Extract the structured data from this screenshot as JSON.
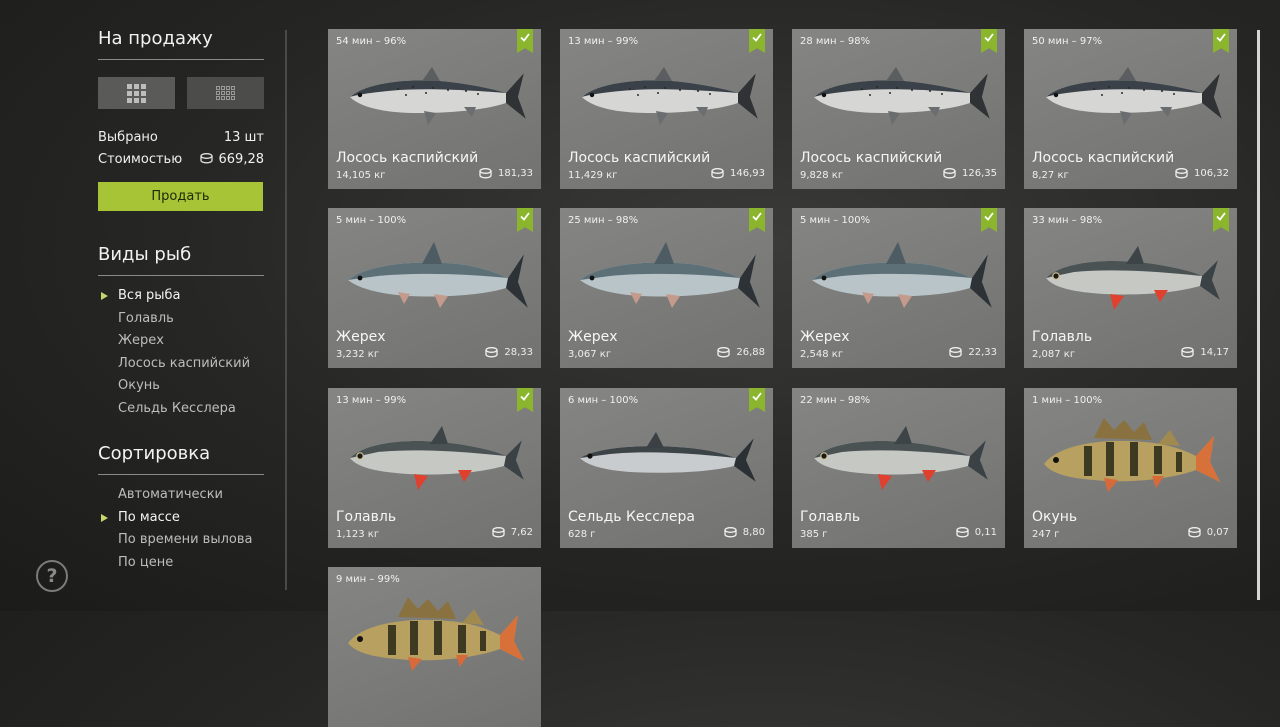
{
  "sidebar": {
    "sale_title": "На продажу",
    "selected_label": "Выбрано",
    "selected_value": "13 шт",
    "cost_label": "Стоимостью",
    "cost_value": "669,28",
    "sell_label": "Продать",
    "species_title": "Виды рыб",
    "species": [
      {
        "label": "Вся рыба",
        "selected": true
      },
      {
        "label": "Голавль",
        "selected": false
      },
      {
        "label": "Жерех",
        "selected": false
      },
      {
        "label": "Лосось каспийский",
        "selected": false
      },
      {
        "label": "Окунь",
        "selected": false
      },
      {
        "label": "Сельдь Кесслера",
        "selected": false
      }
    ],
    "sort_title": "Сортировка",
    "sort": [
      {
        "label": "Автоматически",
        "selected": false
      },
      {
        "label": "По массе",
        "selected": true
      },
      {
        "label": "По времени вылова",
        "selected": false
      },
      {
        "label": "По цене",
        "selected": false
      }
    ],
    "help_label": "?"
  },
  "cards": [
    {
      "info": "54 мин – 96%",
      "checked": true,
      "name": "Лосось каспийский",
      "weight": "14,105 кг",
      "price": "181,33",
      "fish": "salmon"
    },
    {
      "info": "13 мин – 99%",
      "checked": true,
      "name": "Лосось каспийский",
      "weight": "11,429 кг",
      "price": "146,93",
      "fish": "salmon"
    },
    {
      "info": "28 мин – 98%",
      "checked": true,
      "name": "Лосось каспийский",
      "weight": "9,828 кг",
      "price": "126,35",
      "fish": "salmon"
    },
    {
      "info": "50 мин – 97%",
      "checked": true,
      "name": "Лосось каспийский",
      "weight": "8,27 кг",
      "price": "106,32",
      "fish": "salmon"
    },
    {
      "info": "5 мин – 100%",
      "checked": true,
      "name": "Жерех",
      "weight": "3,232 кг",
      "price": "28,33",
      "fish": "asp"
    },
    {
      "info": "25 мин – 98%",
      "checked": true,
      "name": "Жерех",
      "weight": "3,067 кг",
      "price": "26,88",
      "fish": "asp"
    },
    {
      "info": "5 мин – 100%",
      "checked": true,
      "name": "Жерех",
      "weight": "2,548 кг",
      "price": "22,33",
      "fish": "asp"
    },
    {
      "info": "33 мин – 98%",
      "checked": true,
      "name": "Голавль",
      "weight": "2,087 кг",
      "price": "14,17",
      "fish": "chub"
    },
    {
      "info": "13 мин – 99%",
      "checked": true,
      "name": "Голавль",
      "weight": "1,123 кг",
      "price": "7,62",
      "fish": "chub"
    },
    {
      "info": "6 мин – 100%",
      "checked": true,
      "name": "Сельдь Кесслера",
      "weight": "628 г",
      "price": "8,80",
      "fish": "herring"
    },
    {
      "info": "22 мин – 98%",
      "checked": false,
      "name": "Голавль",
      "weight": "385 г",
      "price": "0,11",
      "fish": "chub"
    },
    {
      "info": "1 мин – 100%",
      "checked": false,
      "name": "Окунь",
      "weight": "247 г",
      "price": "0,07",
      "fish": "perch"
    },
    {
      "info": "9 мин – 99%",
      "checked": false,
      "name": "",
      "weight": "",
      "price": "",
      "fish": "perch"
    }
  ],
  "colors": {
    "accent": "#a7c437",
    "check": "#8ab52c",
    "card": "#7c7c7a"
  },
  "icons": {
    "grid_large": "grid-large-icon",
    "grid_small": "grid-small-icon",
    "coin": "coin-icon",
    "check": "check-icon",
    "help": "help-icon"
  }
}
